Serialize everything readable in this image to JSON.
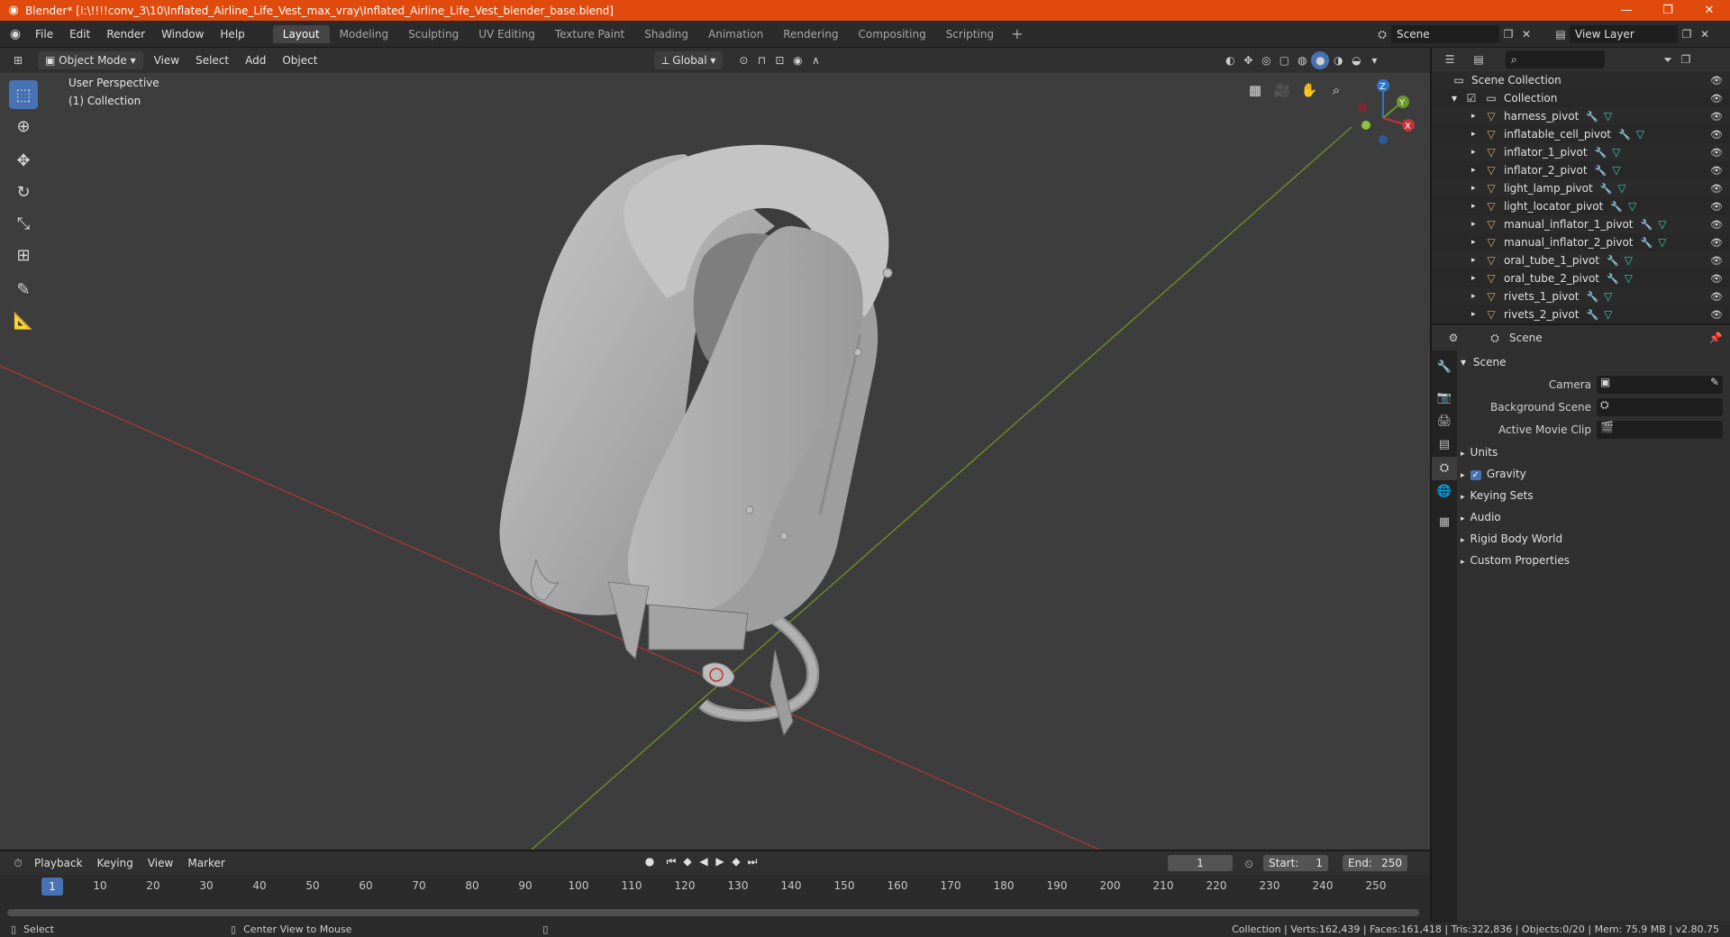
{
  "window": {
    "title": "Blender* [I:\\!!!!conv_3\\10\\Inflated_Airline_Life_Vest_max_vray\\Inflated_Airline_Life_Vest_blender_base.blend]",
    "controls": [
      "—",
      "❐",
      "✕"
    ]
  },
  "top_menu": [
    "File",
    "Edit",
    "Render",
    "Window",
    "Help"
  ],
  "workspace_tabs": [
    "Layout",
    "Modeling",
    "Sculpting",
    "UV Editing",
    "Texture Paint",
    "Shading",
    "Animation",
    "Rendering",
    "Compositing",
    "Scripting"
  ],
  "active_workspace": "Layout",
  "scene_selector": "Scene",
  "view_layer_selector": "View Layer",
  "viewport_header": {
    "mode": "Object Mode",
    "menus": [
      "View",
      "Select",
      "Add",
      "Object"
    ],
    "orientation": "Global"
  },
  "viewport": {
    "perspective_label": "User Perspective",
    "collection_label": "(1) Collection",
    "gizmo_axes": {
      "x": "X",
      "y": "Y",
      "z": "Z"
    }
  },
  "timeline": {
    "menus": [
      "Playback",
      "Keying",
      "View",
      "Marker"
    ],
    "current_frame": "1",
    "start_label": "Start:",
    "start": "1",
    "end_label": "End:",
    "end": "250",
    "ruler_ticks": [
      "10",
      "20",
      "30",
      "40",
      "50",
      "60",
      "70",
      "80",
      "90",
      "100",
      "110",
      "120",
      "130",
      "140",
      "150",
      "160",
      "170",
      "180",
      "190",
      "200",
      "210",
      "220",
      "230",
      "240",
      "250"
    ],
    "cursor_label": "1"
  },
  "statusbar": {
    "left_action": "Select",
    "middle_action": "Center View to Mouse",
    "stats": "Collection | Verts:162,439 | Faces:161,418 | Tris:322,836 | Objects:0/20 | Mem: 75.9 MB | v2.80.75"
  },
  "outliner": {
    "root": "Scene Collection",
    "collection": "Collection",
    "items": [
      "harness_pivot",
      "inflatable_cell_pivot",
      "inflator_1_pivot",
      "inflator_2_pivot",
      "light_lamp_pivot",
      "light_locator_pivot",
      "manual_inflator_1_pivot",
      "manual_inflator_2_pivot",
      "oral_tube_1_pivot",
      "oral_tube_2_pivot",
      "rivets_1_pivot",
      "rivets_2_pivot"
    ]
  },
  "properties": {
    "context": "Scene",
    "section_title": "Scene",
    "fields": [
      {
        "label": "Camera"
      },
      {
        "label": "Background Scene"
      },
      {
        "label": "Active Movie Clip"
      }
    ],
    "subpanels": [
      "Units",
      "Gravity",
      "Keying Sets",
      "Audio",
      "Rigid Body World",
      "Custom Properties"
    ],
    "gravity_checked": true
  },
  "colors": {
    "title_bar": "#e04a0d",
    "accent": "#4772b3",
    "x_axis": "#c0392b",
    "y_axis": "#7a9a2a",
    "mesh_icon": "#2fd2b0",
    "modifier_icon": "#6e9fe0",
    "object_icon": "#e8a85a"
  }
}
